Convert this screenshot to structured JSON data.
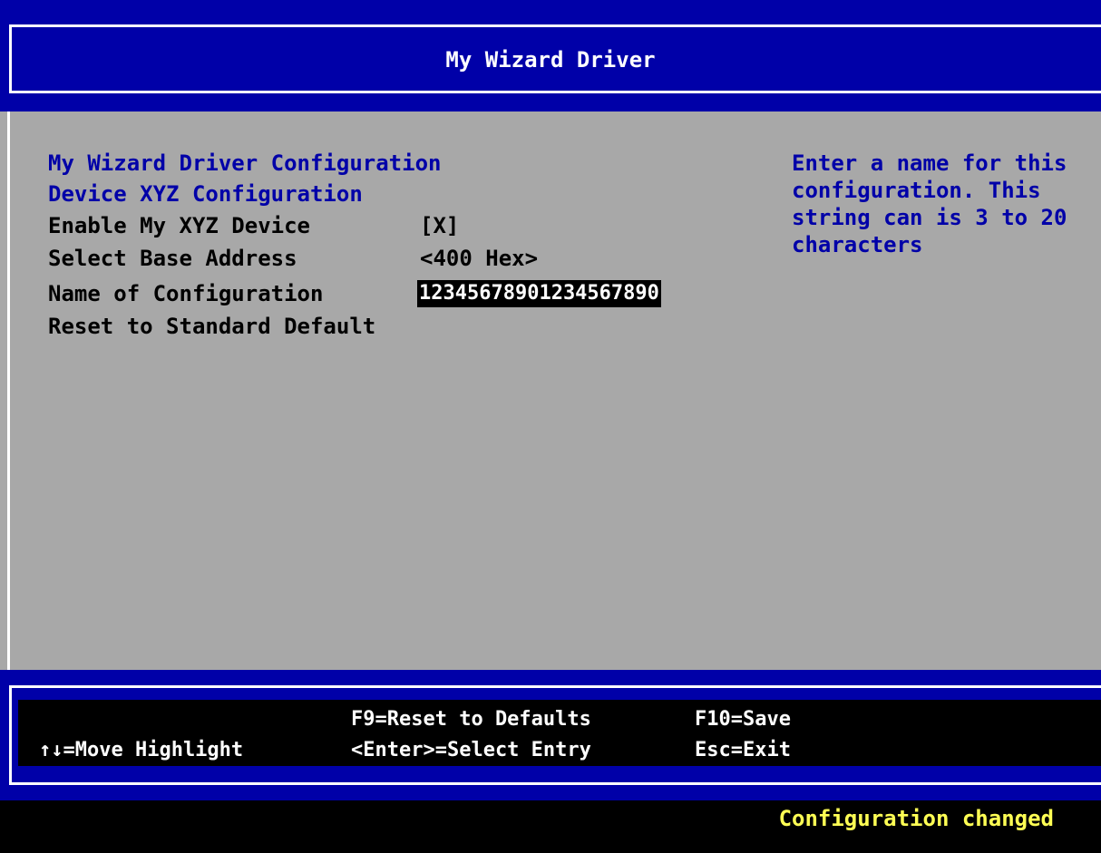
{
  "window": {
    "title": "My Wizard Driver"
  },
  "form": {
    "heading1": "My Wizard Driver Configuration",
    "heading2": "Device XYZ Configuration",
    "items": [
      {
        "label": "Enable My XYZ Device",
        "value": "[X]"
      },
      {
        "label": "Select Base Address",
        "value": "<400 Hex>"
      },
      {
        "label": "Name of Configuration",
        "value": "12345678901234567890"
      },
      {
        "label": "Reset to Standard Default",
        "value": ""
      }
    ]
  },
  "help": {
    "lines": [
      "Enter a name for this",
      "configuration. This",
      "string can is 3 to 20",
      "characters"
    ]
  },
  "footer": {
    "move_highlight": "↑↓=Move Highlight",
    "f9": "F9=Reset to Defaults",
    "enter": "<Enter>=Select Entry",
    "f10": "F10=Save",
    "esc": "Esc=Exit"
  },
  "status": {
    "message": "Configuration changed"
  },
  "colors": {
    "bios_blue": "#0000a8",
    "bios_gray": "#a8a8a8",
    "status_yellow": "#ffff54"
  }
}
